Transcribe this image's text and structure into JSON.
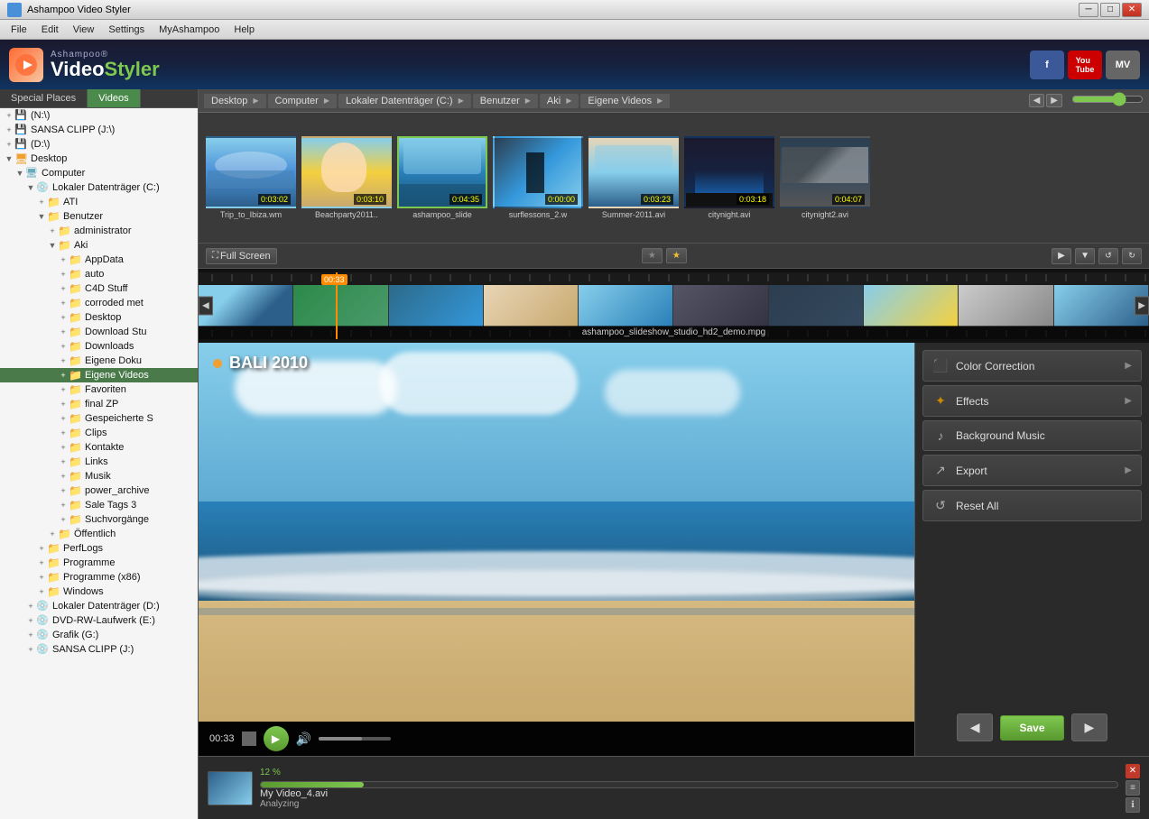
{
  "window": {
    "title": "Ashampoo Video Styler",
    "min_btn": "─",
    "max_btn": "□",
    "close_btn": "✕"
  },
  "menu": {
    "items": [
      "File",
      "Edit",
      "View",
      "Settings",
      "MyAshampoo",
      "Help"
    ]
  },
  "header": {
    "brand_top": "Ashampoo®",
    "brand_video": "Video",
    "brand_styler": "Styler",
    "social": [
      "f",
      "You Tube",
      "MV"
    ]
  },
  "sidebar": {
    "tab_special": "Special Places",
    "tab_videos": "Videos",
    "drives": [
      {
        "label": "(N:\\)"
      },
      {
        "label": "SANSA CLIPP (J:\\)"
      },
      {
        "label": "(D:\\)"
      }
    ],
    "tree": [
      {
        "label": "Desktop",
        "level": 0,
        "expanded": true
      },
      {
        "label": "Computer",
        "level": 1,
        "expanded": true
      },
      {
        "label": "Lokaler Datenträger (C:)",
        "level": 2,
        "expanded": true
      },
      {
        "label": "ATI",
        "level": 3,
        "expanded": false
      },
      {
        "label": "Benutzer",
        "level": 3,
        "expanded": true
      },
      {
        "label": "administrator",
        "level": 4,
        "expanded": false
      },
      {
        "label": "Aki",
        "level": 4,
        "expanded": true
      },
      {
        "label": "AppData",
        "level": 5,
        "expanded": false
      },
      {
        "label": "auto",
        "level": 5,
        "expanded": false
      },
      {
        "label": "C4D Stuff",
        "level": 5,
        "expanded": false
      },
      {
        "label": "corroded met",
        "level": 5,
        "expanded": false
      },
      {
        "label": "Desktop",
        "level": 5,
        "expanded": false
      },
      {
        "label": "Download Stu",
        "level": 5,
        "expanded": false
      },
      {
        "label": "Downloads",
        "level": 5,
        "expanded": false
      },
      {
        "label": "Eigene Doku",
        "level": 5,
        "expanded": false
      },
      {
        "label": "Eigene Videos",
        "level": 5,
        "expanded": false,
        "selected": true
      },
      {
        "label": "Favoriten",
        "level": 5,
        "expanded": false
      },
      {
        "label": "final ZP",
        "level": 5,
        "expanded": false
      },
      {
        "label": "Gespeicherte S",
        "level": 5,
        "expanded": false
      },
      {
        "label": "Clips",
        "level": 5,
        "expanded": false
      },
      {
        "label": "Kontakte",
        "level": 5,
        "expanded": false
      },
      {
        "label": "Links",
        "level": 5,
        "expanded": false
      },
      {
        "label": "Musik",
        "level": 5,
        "expanded": false
      },
      {
        "label": "power_archive",
        "level": 5,
        "expanded": false
      },
      {
        "label": "Sale Tags 3",
        "level": 5,
        "expanded": false
      },
      {
        "label": "Suchvorgänge",
        "level": 5,
        "expanded": false
      },
      {
        "label": "Öffentlich",
        "level": 4,
        "expanded": false
      },
      {
        "label": "PerfLogs",
        "level": 3,
        "expanded": false
      },
      {
        "label": "Programme",
        "level": 3,
        "expanded": false
      },
      {
        "label": "Programme (x86)",
        "level": 3,
        "expanded": false
      },
      {
        "label": "Windows",
        "level": 3,
        "expanded": false
      },
      {
        "label": "Lokaler Datenträger (D:)",
        "level": 2,
        "expanded": false
      },
      {
        "label": "DVD-RW-Laufwerk (E:)",
        "level": 2,
        "expanded": false
      },
      {
        "label": "Grafik (G:)",
        "level": 2,
        "expanded": false
      },
      {
        "label": "SANSA CLIPP (J:)",
        "level": 2,
        "expanded": false
      }
    ]
  },
  "breadcrumb": {
    "items": [
      "Desktop",
      "Computer",
      "Lokaler Datenträger (C:)",
      "Benutzer",
      "Aki",
      "Eigene Videos"
    ]
  },
  "thumbnails": [
    {
      "label": "Trip_to_Ibiza.wm",
      "time": "0:03:02",
      "style": "sky"
    },
    {
      "label": "Beachparty2011..",
      "time": "0:03:10",
      "style": "beach"
    },
    {
      "label": "ashampoo_slide",
      "time": "0:04:35",
      "style": "ocean",
      "selected": true
    },
    {
      "label": "surflessons_2.w",
      "time": "0:00:00",
      "style": "surf"
    },
    {
      "label": "Summer-2011.avi",
      "time": "0:03:23",
      "style": "summer"
    },
    {
      "label": "citynight.avi",
      "time": "0:03:18",
      "style": "city"
    },
    {
      "label": "citynight2.avi",
      "time": "0:04:07",
      "style": "city2"
    }
  ],
  "timeline": {
    "fullscreen_label": "Full Screen",
    "playhead_time": "00:33",
    "filename": "ashampoo_slideshow_studio_hd2_demo.mpg"
  },
  "preview": {
    "video_title": "BALI 2010",
    "time": "00:33"
  },
  "right_panel": {
    "color_correction": "Color Correction",
    "effects": "Effects",
    "background_music": "Background Music",
    "export": "Export",
    "reset_all": "Reset All",
    "save": "Save"
  },
  "task_bar": {
    "filename": "My Video_4.avi",
    "status": "Analyzing",
    "percent": "12 %"
  }
}
